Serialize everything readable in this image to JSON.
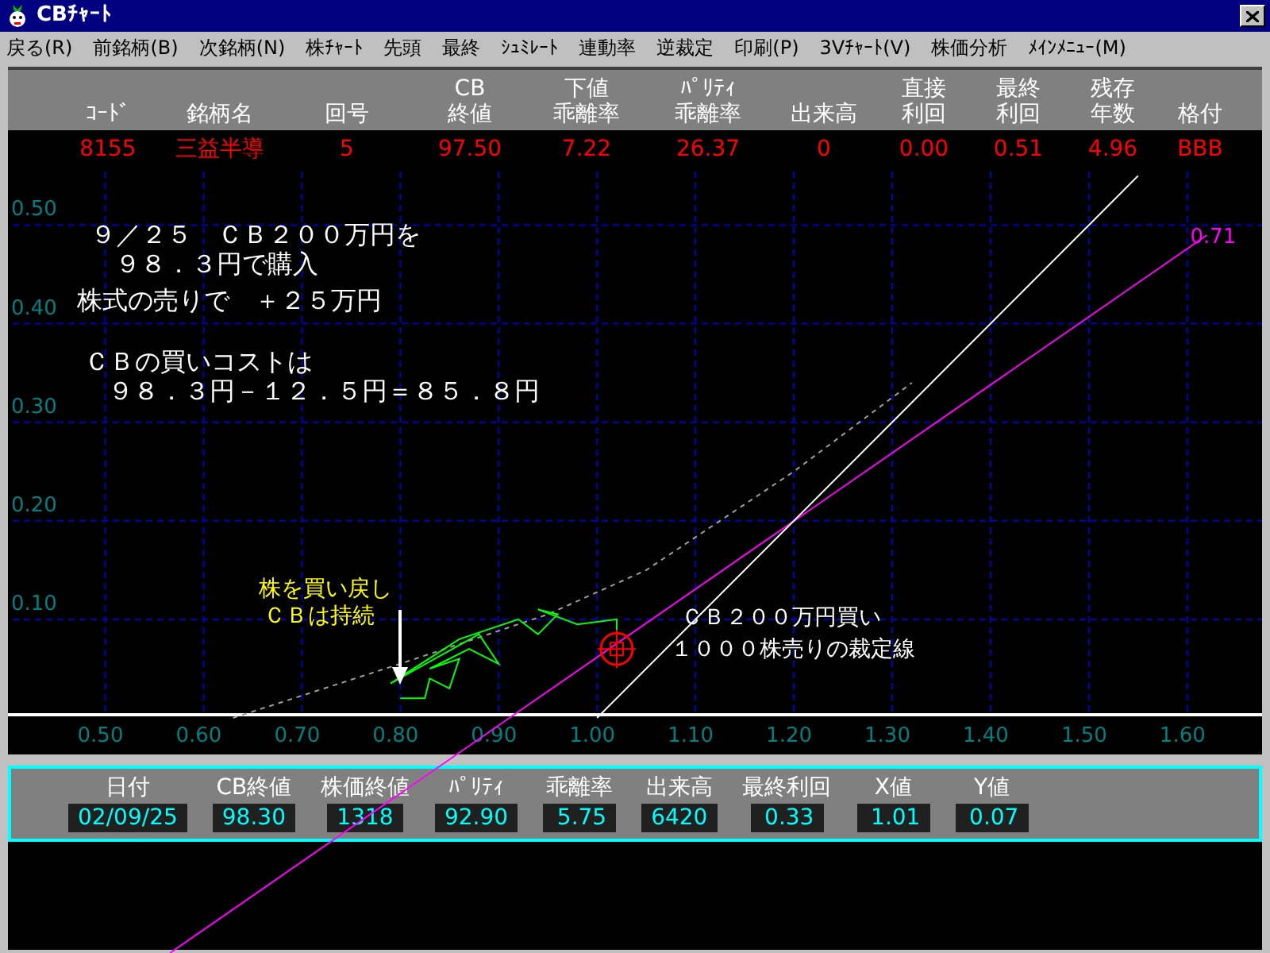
{
  "window": {
    "title": "CBﾁｬｰﾄ"
  },
  "menu": [
    "戻る(R)",
    "前銘柄(B)",
    "次銘柄(N)",
    "株ﾁｬｰﾄ",
    "先頭",
    "最終",
    "ｼｭﾐﾚｰﾄ",
    "連動率",
    "逆裁定",
    "印刷(P)",
    "3Vﾁｬｰﾄ(V)",
    "株価分析",
    "ﾒｲﾝﾒﾆｭｰ(M)"
  ],
  "table": {
    "columns": [
      [
        "ｺｰﾄﾞ"
      ],
      [
        "銘柄名"
      ],
      [
        "回号"
      ],
      [
        "CB",
        "終値"
      ],
      [
        "下値",
        "乖離率"
      ],
      [
        "ﾊﾟﾘﾃｨ",
        "乖離率"
      ],
      [
        "出来高"
      ],
      [
        "直接",
        "利回"
      ],
      [
        "最終",
        "利回"
      ],
      [
        "残存",
        "年数"
      ],
      [
        "格付"
      ]
    ],
    "row": [
      "8155",
      "三益半導",
      "5",
      "97.50",
      "7.22",
      "26.37",
      "0",
      "0.00",
      "0.51",
      "4.96",
      "BBB"
    ]
  },
  "chart": {
    "chart_data": {
      "type": "line",
      "xlim": [
        0.406,
        1.676
      ],
      "ylim": [
        0,
        0.556
      ],
      "grid": true,
      "xticks": [
        {
          "value": 0.5,
          "label": "0.50"
        },
        {
          "value": 0.6,
          "label": "0.60"
        },
        {
          "value": 0.7,
          "label": "0.70"
        },
        {
          "value": 0.8,
          "label": "0.80"
        },
        {
          "value": 0.9,
          "label": "0.90"
        },
        {
          "value": 1.0,
          "label": "1.00"
        },
        {
          "value": 1.1,
          "label": "1.10"
        },
        {
          "value": 1.2,
          "label": "1.20"
        },
        {
          "value": 1.3,
          "label": "1.30"
        },
        {
          "value": 1.4,
          "label": "1.40"
        },
        {
          "value": 1.5,
          "label": "1.50"
        },
        {
          "value": 1.6,
          "label": "1.60"
        }
      ],
      "yticks": [
        {
          "value": 0.1,
          "label": "0.10"
        },
        {
          "value": 0.2,
          "label": "0.20"
        },
        {
          "value": 0.3,
          "label": "0.30"
        },
        {
          "value": 0.4,
          "label": "0.40"
        },
        {
          "value": 0.5,
          "label": "0.50"
        }
      ],
      "series": [
        {
          "color": "#ff00ff",
          "x": [
            0.911,
            1.62
          ],
          "values": [
            0,
            0.49
          ]
        },
        {
          "color": "#ffffff",
          "x": [
            1.0,
            1.55
          ],
          "values": [
            0,
            0.55
          ]
        },
        {
          "color": "#a0a0a0",
          "line_style": "dashed",
          "x": [
            0.63,
            0.8,
            0.95,
            1.05,
            1.2,
            1.32
          ],
          "values": [
            0,
            0.055,
            0.105,
            0.15,
            0.25,
            0.34
          ]
        },
        {
          "color": "#00ff00",
          "x": [
            0.8,
            0.825,
            0.83,
            0.85,
            0.86,
            0.83,
            0.87,
            0.9,
            0.88,
            0.79,
            0.86,
            0.92,
            0.94,
            0.96,
            0.94,
            0.98,
            1.02,
            1.02
          ],
          "values": [
            0.02,
            0.02,
            0.04,
            0.03,
            0.06,
            0.05,
            0.07,
            0.055,
            0.085,
            0.035,
            0.08,
            0.1,
            0.085,
            0.105,
            0.11,
            0.095,
            0.1,
            0.07
          ]
        }
      ]
    },
    "notes": [
      {
        "text": "９／２５　ＣＢ２００万円を",
        "color": "#ffffff"
      },
      {
        "text": "９８．３円で購入",
        "color": "#ffffff"
      },
      {
        "text": "株式の売りで　＋２５万円",
        "color": "#ffffff"
      },
      {
        "text": "ＣＢの買いコストは",
        "color": "#ffffff"
      },
      {
        "text": "９８．３円－１２．５円＝８５．８円",
        "color": "#ffffff"
      },
      {
        "text": "株を買い戻し",
        "color": "#ffff00"
      },
      {
        "text": "ＣＢは持続",
        "color": "#ffff00"
      },
      {
        "text": "ＣＢ２００万円買い",
        "color": "#ffffff"
      },
      {
        "text": "１０００株売りの裁定線",
        "color": "#ffffff"
      },
      {
        "text": "0.71",
        "color": "#ff00ff"
      }
    ]
  },
  "readout": [
    {
      "label": "日付",
      "value": "02/09/25"
    },
    {
      "label": "CB終値",
      "value": "98.30"
    },
    {
      "label": "株価終値",
      "value": "1318"
    },
    {
      "label": "ﾊﾟﾘﾃｨ",
      "value": "92.90"
    },
    {
      "label": "乖離率",
      "value": "5.75"
    },
    {
      "label": "出来高",
      "value": "6420"
    },
    {
      "label": "最終利回",
      "value": "0.33"
    },
    {
      "label": "X値",
      "value": "1.01"
    },
    {
      "label": "Y値",
      "value": "0.07"
    }
  ]
}
